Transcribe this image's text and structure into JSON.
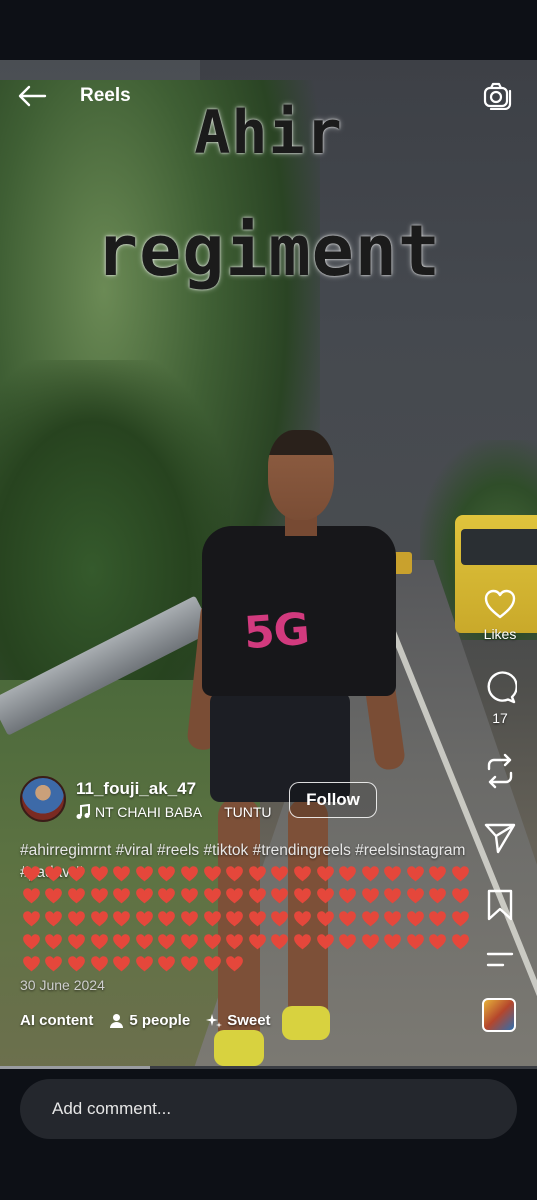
{
  "header": {
    "title": "Reels"
  },
  "overlay_text": {
    "line1": "Ahir",
    "line2": "regiment"
  },
  "actions": {
    "like_label": "Likes",
    "comment_count": "17"
  },
  "author": {
    "username": "11_fouji_ak_47",
    "audio_left": "NT CHAHI BABA",
    "audio_right": "TUNTU",
    "follow_label": "Follow"
  },
  "caption": {
    "hashtags": "#ahirregimrnt #viral #reels #tiktok #trendingreels #reelsinstagram #yadav #",
    "hearts": "❤️❤️❤️❤️❤️❤️❤️❤️❤️❤️❤️❤️❤️❤️❤️❤️❤️❤️❤️❤️❤️❤️❤️❤️❤️❤️❤️❤️❤️❤️❤️❤️❤️❤️❤️❤️❤️❤️❤️❤️❤️❤️❤️❤️❤️❤️❤️❤️❤️❤️❤️❤️❤️❤️❤️❤️❤️❤️❤️❤️❤️❤️❤️❤️❤️❤️❤️❤️❤️❤️❤️❤️❤️❤️❤️❤️❤️❤️❤️❤️❤️❤️❤️❤️❤️❤️❤️❤️❤️❤️",
    "heart_count": 90
  },
  "date": "30 June 2024",
  "meta": {
    "ai_label": "AI content",
    "people_label": "5 people",
    "sweet_label": "Sweet"
  },
  "progress_fraction": 0.28,
  "comment": {
    "placeholder": "Add comment..."
  },
  "icons": {
    "back": "arrow-left-icon",
    "camera": "camera-icon",
    "like": "heart-icon",
    "comment": "comment-icon",
    "repost": "repost-icon",
    "share": "send-icon",
    "save": "bookmark-icon",
    "more": "more-icon",
    "person": "person-icon",
    "sparkle": "sparkle-icon",
    "music": "music-note-icon"
  },
  "colors": {
    "background": "#0d1016",
    "heart": "#e5473b",
    "comment_box": "#24272d"
  }
}
